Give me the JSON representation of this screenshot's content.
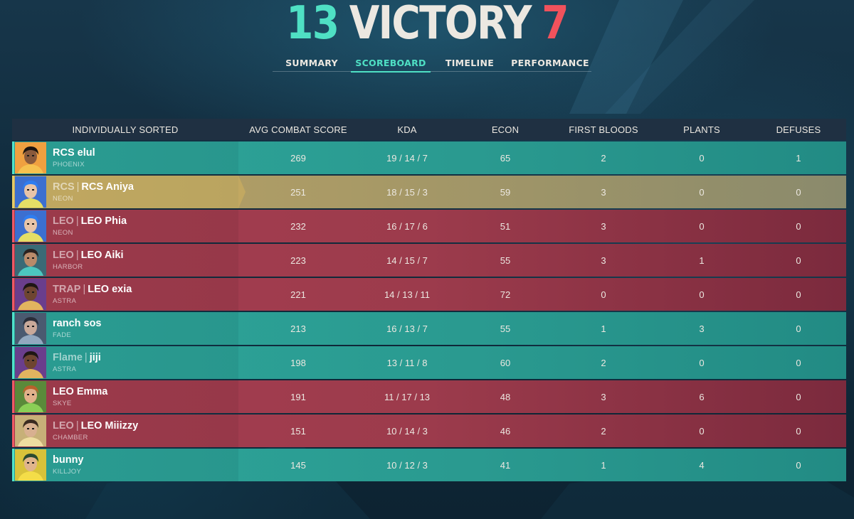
{
  "match": {
    "team_score": "13",
    "result": "VICTORY",
    "enemy_score": "7"
  },
  "tabs": [
    {
      "label": "SUMMARY",
      "active": false
    },
    {
      "label": "SCOREBOARD",
      "active": true
    },
    {
      "label": "TIMELINE",
      "active": false
    },
    {
      "label": "PERFORMANCE",
      "active": false
    }
  ],
  "scoreboard": {
    "headers": {
      "name": "INDIVIDUALLY SORTED",
      "acs": "AVG COMBAT SCORE",
      "kda": "KDA",
      "econ": "ECON",
      "first_bloods": "FIRST BLOODS",
      "plants": "PLANTS",
      "defuses": "DEFUSES"
    },
    "players": [
      {
        "team_tag": "",
        "name": "RCS elul",
        "agent": "PHOENIX",
        "side": "ally",
        "acs": "269",
        "kda": "19 / 14 / 7",
        "econ": "65",
        "first_bloods": "2",
        "plants": "0",
        "defuses": "1",
        "avatar_icon": "phoenix-portrait"
      },
      {
        "team_tag": "RCS",
        "name": "RCS Aniya",
        "agent": "NEON",
        "side": "self",
        "acs": "251",
        "kda": "18 / 15 / 3",
        "econ": "59",
        "first_bloods": "3",
        "plants": "0",
        "defuses": "0",
        "avatar_icon": "neon-portrait"
      },
      {
        "team_tag": "LEO",
        "name": "LEO Phia",
        "agent": "NEON",
        "side": "enemy",
        "acs": "232",
        "kda": "16 / 17 / 6",
        "econ": "51",
        "first_bloods": "3",
        "plants": "0",
        "defuses": "0",
        "avatar_icon": "neon-portrait"
      },
      {
        "team_tag": "LEO",
        "name": "LEO Aiki",
        "agent": "HARBOR",
        "side": "enemy",
        "acs": "223",
        "kda": "14 / 15 / 7",
        "econ": "55",
        "first_bloods": "3",
        "plants": "1",
        "defuses": "0",
        "avatar_icon": "harbor-portrait"
      },
      {
        "team_tag": "TRAP",
        "name": "LEO exia",
        "agent": "ASTRA",
        "side": "enemy",
        "acs": "221",
        "kda": "14 / 13 / 11",
        "econ": "72",
        "first_bloods": "0",
        "plants": "0",
        "defuses": "0",
        "avatar_icon": "astra-portrait"
      },
      {
        "team_tag": "",
        "name": "ranch sos",
        "agent": "FADE",
        "side": "ally",
        "acs": "213",
        "kda": "16 / 13 / 7",
        "econ": "55",
        "first_bloods": "1",
        "plants": "3",
        "defuses": "0",
        "avatar_icon": "fade-portrait"
      },
      {
        "team_tag": "Flame",
        "name": "jiji",
        "agent": "ASTRA",
        "side": "ally",
        "acs": "198",
        "kda": "13 / 11 / 8",
        "econ": "60",
        "first_bloods": "2",
        "plants": "0",
        "defuses": "0",
        "avatar_icon": "astra-portrait"
      },
      {
        "team_tag": "",
        "name": "LEO Emma",
        "agent": "SKYE",
        "side": "enemy",
        "acs": "191",
        "kda": "11 / 17 / 13",
        "econ": "48",
        "first_bloods": "3",
        "plants": "6",
        "defuses": "0",
        "avatar_icon": "skye-portrait"
      },
      {
        "team_tag": "LEO",
        "name": "LEO Miiizzy",
        "agent": "CHAMBER",
        "side": "enemy",
        "acs": "151",
        "kda": "10 / 14 / 3",
        "econ": "46",
        "first_bloods": "2",
        "plants": "0",
        "defuses": "0",
        "avatar_icon": "chamber-portrait"
      },
      {
        "team_tag": "",
        "name": "bunny",
        "agent": "KILLJOY",
        "side": "ally",
        "acs": "145",
        "kda": "10 / 12 / 3",
        "econ": "41",
        "first_bloods": "1",
        "plants": "4",
        "defuses": "0",
        "avatar_icon": "killjoy-portrait"
      }
    ]
  },
  "colors": {
    "win": "#4fe0c4",
    "lose": "#f0525c",
    "ally_row": "#2da59a",
    "enemy_row": "#a63e50",
    "self_row": "#b8a164"
  }
}
